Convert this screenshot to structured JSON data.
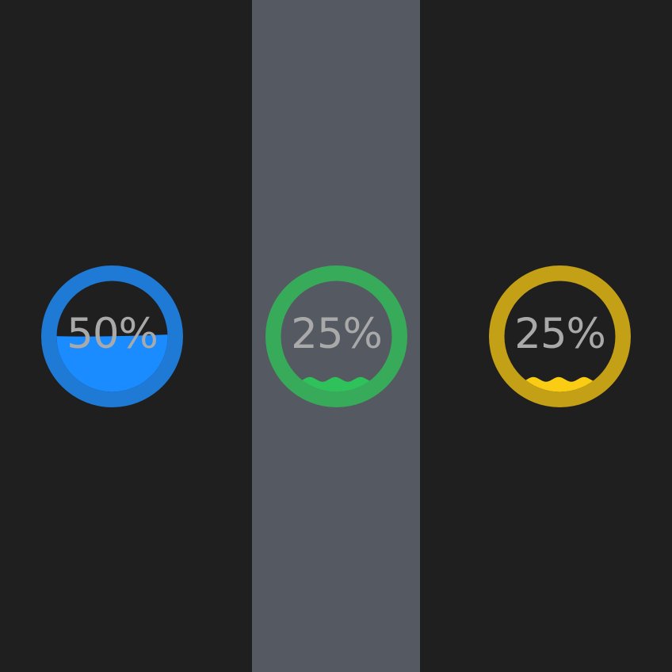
{
  "gauges": [
    {
      "label": "50%",
      "level": 0.5,
      "wave": "flat",
      "ring_color": "#1e7ad4",
      "ring_inner": "#1b74c9",
      "fill_color": "#1a8cff",
      "inner_bg": "#1f1f1f"
    },
    {
      "label": "25%",
      "level": 0.25,
      "wave": "wavy",
      "ring_color": "#37ab5a",
      "ring_inner": "#34a657",
      "fill_color": "#2fc25b",
      "inner_bg": "#555961"
    },
    {
      "label": "25%",
      "level": 0.25,
      "wave": "wavy",
      "ring_color": "#c4a016",
      "ring_inner": "#bd9a15",
      "fill_color": "#facc14",
      "inner_bg": "#1f1f1f"
    }
  ]
}
